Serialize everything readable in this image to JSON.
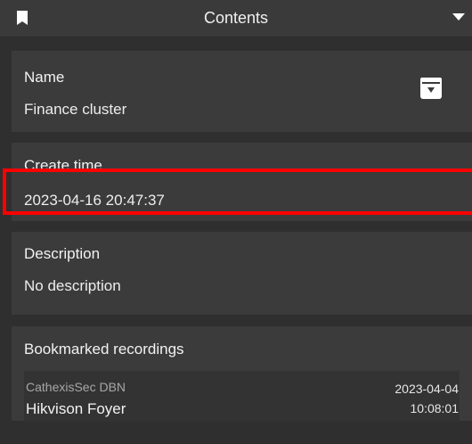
{
  "header": {
    "title": "Contents",
    "bookmark_icon": "bookmark-icon",
    "collapse_icon": "chevron-down-icon"
  },
  "name_panel": {
    "label": "Name",
    "value": "Finance cluster",
    "archive_icon": "archive-download-icon"
  },
  "create_panel": {
    "label": "Create time",
    "value": "2023-04-16 20:47:37"
  },
  "description_panel": {
    "label": "Description",
    "value": "No description"
  },
  "bookmarks_panel": {
    "label": "Bookmarked recordings",
    "recordings": [
      {
        "source": "CathexisSec DBN",
        "camera": "Hikvison Foyer",
        "date": "2023-04-04",
        "time": "10:08:01"
      }
    ]
  },
  "colors": {
    "background": "#2f2f2f",
    "panel": "#3b3b3b",
    "highlight": "#ff0000"
  }
}
